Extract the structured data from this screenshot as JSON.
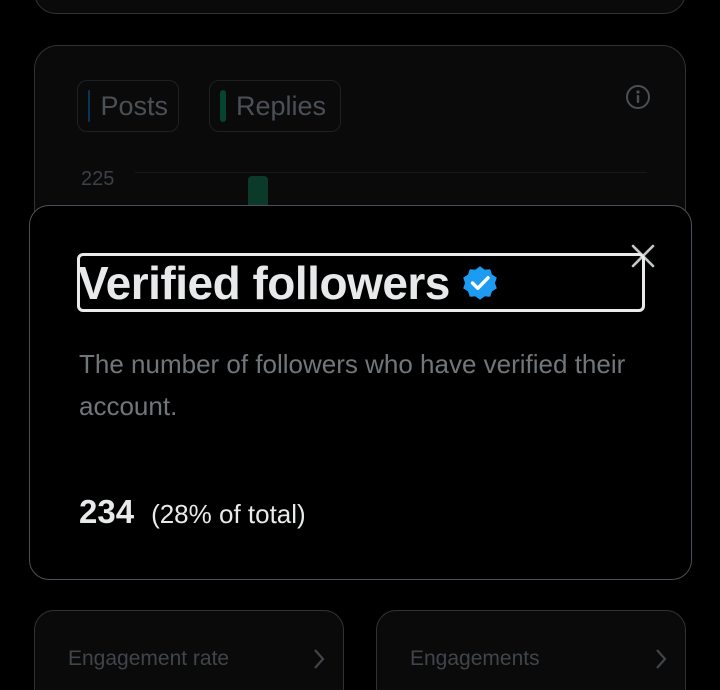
{
  "chart_card": {
    "tabs": [
      {
        "label": "Posts",
        "color": "#1d9bf0"
      },
      {
        "label": "Replies",
        "color": "#00ba7c"
      }
    ],
    "y_tick": "225"
  },
  "modal": {
    "title": "Verified followers",
    "description": "The number of followers who have verified their account.",
    "count": "234",
    "share": "(28% of total)"
  },
  "metric_cards": [
    {
      "label": "Engagement rate"
    },
    {
      "label": "Engagements"
    }
  ],
  "colors": {
    "verified_badge": "#1d9bf0",
    "background": "#000000"
  }
}
